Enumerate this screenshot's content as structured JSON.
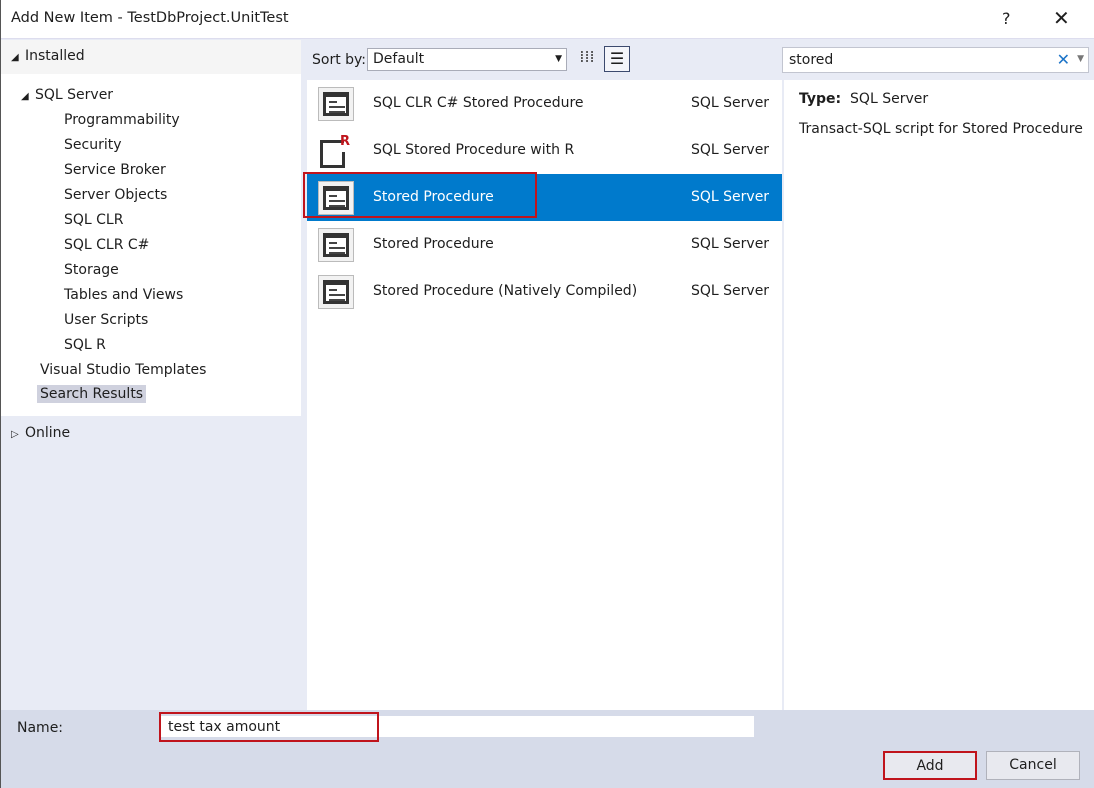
{
  "window": {
    "title": "Add New Item - TestDbProject.UnitTest",
    "help": "?",
    "close": "✕"
  },
  "tree": {
    "installed": "Installed",
    "sql_server": "SQL Server",
    "children": [
      "Programmability",
      "Security",
      "Service Broker",
      "Server Objects",
      "SQL CLR",
      "SQL CLR C#",
      "Storage",
      "Tables and Views",
      "User Scripts",
      "SQL R"
    ],
    "vs_templates": "Visual Studio Templates",
    "search_results": "Search Results",
    "online": "Online"
  },
  "toolbar": {
    "sort_label": "Sort by:",
    "sort_value": "Default",
    "search_value": "stored"
  },
  "items": [
    {
      "name": "SQL CLR C# Stored Procedure",
      "type": "SQL Server"
    },
    {
      "name": "SQL Stored Procedure with R",
      "type": "SQL Server"
    },
    {
      "name": "Stored Procedure",
      "type": "SQL Server"
    },
    {
      "name": "Stored Procedure",
      "type": "SQL Server"
    },
    {
      "name": "Stored Procedure (Natively Compiled)",
      "type": "SQL Server"
    }
  ],
  "detail": {
    "type_label": "Type:",
    "type_value": "SQL Server",
    "description": "Transact-SQL script for Stored Procedure"
  },
  "footer": {
    "name_label": "Name:",
    "name_value": "test tax amount",
    "add": "Add",
    "cancel": "Cancel"
  },
  "colors": {
    "selection": "#007acc",
    "highlight": "#c0141c"
  }
}
